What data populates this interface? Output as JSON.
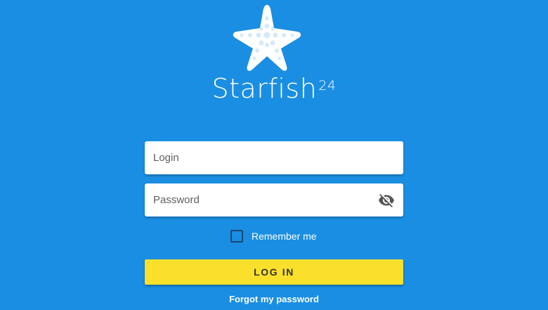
{
  "brand": {
    "name": "Starfish",
    "superscript": "24",
    "logo_icon": "starfish-icon"
  },
  "form": {
    "login_placeholder": "Login",
    "password_placeholder": "Password",
    "visibility_icon": "eye-off-icon",
    "remember_label": "Remember me",
    "remember_checked": false,
    "login_button": "LOG IN",
    "forgot_link": "Forgot my password"
  },
  "colors": {
    "background": "#1a8ee2",
    "button": "#fbe02b",
    "field": "#ffffff",
    "text_light": "#ffffff"
  }
}
